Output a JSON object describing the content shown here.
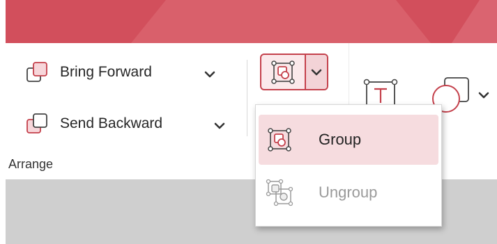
{
  "ribbon": {
    "arrange_group": {
      "label": "Arrange",
      "bring_forward": {
        "label": "Bring Forward",
        "icon": "bring-forward-icon"
      },
      "send_backward": {
        "label": "Send Backward",
        "icon": "send-backward-icon"
      }
    },
    "group_split_button": {
      "icon": "group-objects-icon",
      "dropdown_icon": "chevron-down-icon"
    },
    "insert_textbox_icon": "textbox-icon",
    "shapes_icon": "shapes-icon"
  },
  "group_menu": {
    "items": [
      {
        "label": "Group",
        "icon": "group-objects-icon",
        "state": "highlighted"
      },
      {
        "label": "Ungroup",
        "icon": "ungroup-objects-icon",
        "state": "disabled"
      }
    ]
  },
  "colors": {
    "accent": "#c4404b",
    "titlebar": "#d24f5c",
    "highlight": "#f6dcdf",
    "disabled_text": "#9a9a9a"
  }
}
